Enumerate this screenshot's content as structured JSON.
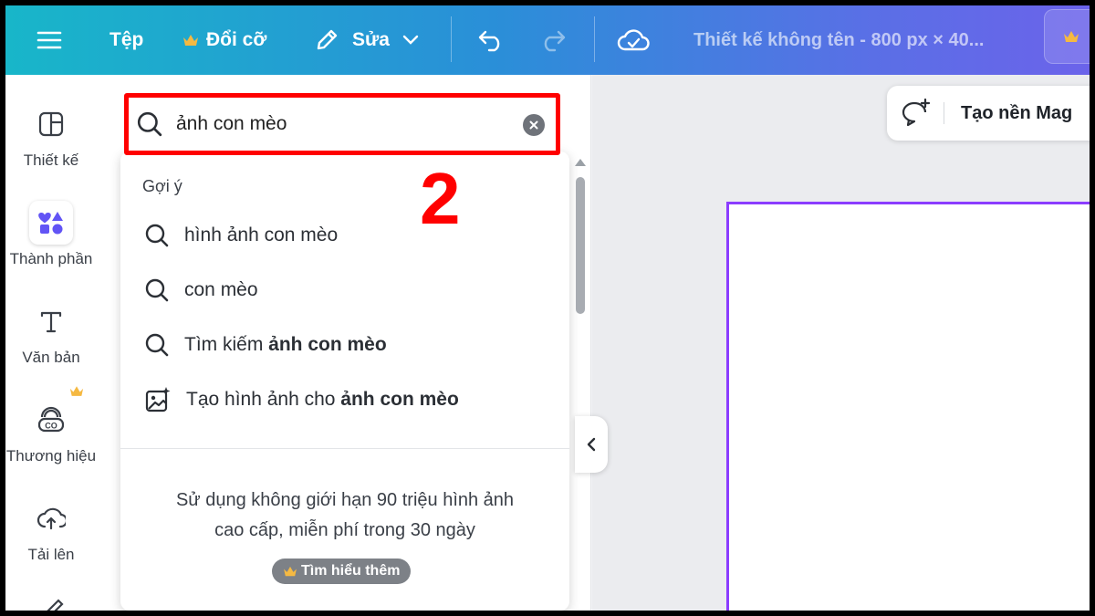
{
  "topbar": {
    "file": "Tệp",
    "resize": "Đổi cỡ",
    "edit": "Sửa",
    "doc_title": "Thiết kế không tên - 800 px × 40..."
  },
  "rail": {
    "items": [
      {
        "label": "Thiết kế",
        "icon": "layout-icon"
      },
      {
        "label": "Thành phần",
        "icon": "elements-icon"
      },
      {
        "label": "Văn bản",
        "icon": "text-icon"
      },
      {
        "label": "Thương hiệu",
        "icon": "brand-icon"
      },
      {
        "label": "Tải lên",
        "icon": "upload-cloud-icon"
      }
    ]
  },
  "search": {
    "value": "ảnh con mèo"
  },
  "annotation": {
    "step": "2"
  },
  "suggestions": {
    "heading": "Gợi ý",
    "items": [
      {
        "text": "hình ảnh con mèo",
        "bold": ""
      },
      {
        "text": "con mèo",
        "bold": ""
      },
      {
        "text": "Tìm kiếm ",
        "bold": "ảnh con mèo"
      },
      {
        "text": "Tạo hình ảnh cho ",
        "bold": "ảnh con mèo"
      }
    ]
  },
  "promo": {
    "line1": "Sử dụng không giới hạn 90 triệu hình ảnh",
    "line2": "cao cấp, miễn phí trong 30 ngày",
    "button": "Tìm hiểu thêm"
  },
  "canvas": {
    "magic_button": "Tạo nền Mag"
  },
  "colors": {
    "highlight": "#ff0000",
    "page_border": "#8b3dff",
    "crown": "#f5b942"
  }
}
